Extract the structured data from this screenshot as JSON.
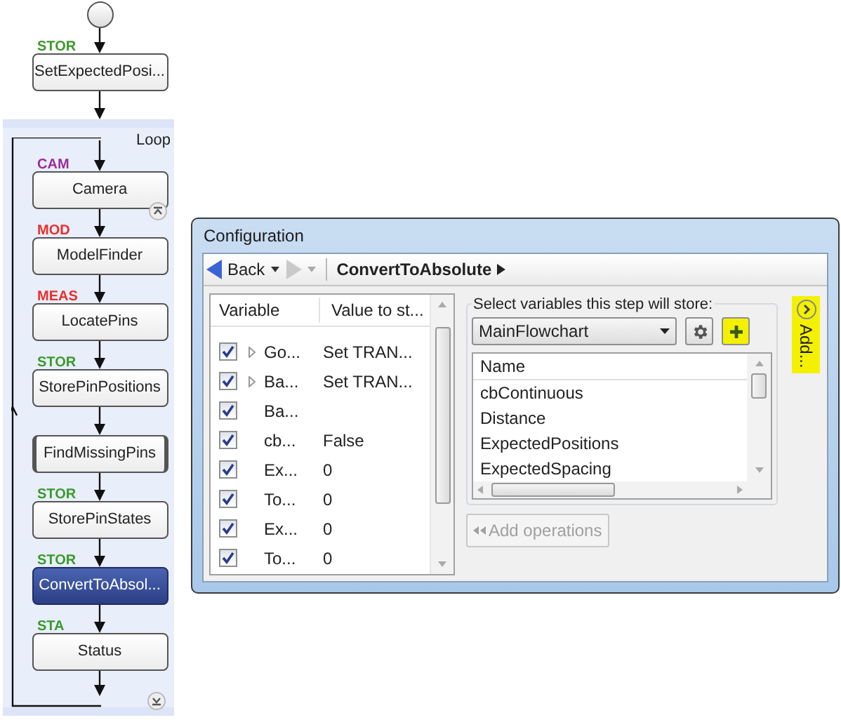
{
  "flowchart": {
    "top_nodes": [
      {
        "tag": "STOR",
        "color": "#3a9a2a",
        "label": "SetExpectedPosi...",
        "selected": false
      }
    ],
    "loop": {
      "label": "Loop",
      "nodes": [
        {
          "tag": "CAM",
          "color": "#9b2d9b",
          "label": "Camera",
          "kind": "step",
          "selected": false,
          "collapse_button": true
        },
        {
          "tag": "MOD",
          "color": "#e8302a",
          "label": "ModelFinder",
          "kind": "step",
          "selected": false,
          "collapse_button": false
        },
        {
          "tag": "MEAS",
          "color": "#e8302a",
          "label": "LocatePins",
          "kind": "step",
          "selected": false,
          "collapse_button": false
        },
        {
          "tag": "STOR",
          "color": "#3a9a2a",
          "label": "StorePinPositions",
          "kind": "step",
          "selected": false,
          "collapse_button": false
        },
        {
          "label": "FindMissingPins",
          "kind": "subflow",
          "selected": false,
          "collapse_button": false
        },
        {
          "tag": "STOR",
          "color": "#3a9a2a",
          "label": "StorePinStates",
          "kind": "step",
          "selected": false,
          "collapse_button": false
        },
        {
          "tag": "STOR",
          "color": "#3a9a2a",
          "label": "ConvertToAbsol...",
          "kind": "step",
          "selected": true,
          "collapse_button": false
        },
        {
          "tag": "STA",
          "color": "#3a9a2a",
          "label": "Status",
          "kind": "step",
          "selected": false,
          "collapse_button": false
        }
      ]
    }
  },
  "configuration": {
    "title": "Configuration",
    "nav": {
      "back": "Back",
      "current": "ConvertToAbsolute"
    },
    "variables": {
      "columns": [
        "Variable",
        "Value to st..."
      ],
      "rows": [
        {
          "checked": true,
          "expandable": true,
          "name": "Go...",
          "value": "Set TRAN..."
        },
        {
          "checked": true,
          "expandable": true,
          "name": "Ba...",
          "value": "Set TRAN..."
        },
        {
          "checked": true,
          "expandable": false,
          "name": "Ba..."
        },
        {
          "checked": true,
          "expandable": false,
          "name": "cb...",
          "value": "False"
        },
        {
          "checked": true,
          "expandable": false,
          "name": "Ex...",
          "value": "0"
        },
        {
          "checked": true,
          "expandable": false,
          "name": "To...",
          "value": "0"
        },
        {
          "checked": true,
          "expandable": false,
          "name": "Ex...",
          "value": "0"
        },
        {
          "checked": true,
          "expandable": false,
          "name": "To...",
          "value": "0"
        }
      ]
    },
    "store": {
      "label": "Select variables this step will store:",
      "dropdown": "MainFlowchart",
      "column": "Name",
      "items": [
        "cbContinuous",
        "Distance",
        "ExpectedPositions",
        "ExpectedSpacing"
      ],
      "add_operations": {
        "label": "Add operations",
        "disabled": true
      }
    },
    "side_panel": {
      "label": "Add..."
    }
  }
}
